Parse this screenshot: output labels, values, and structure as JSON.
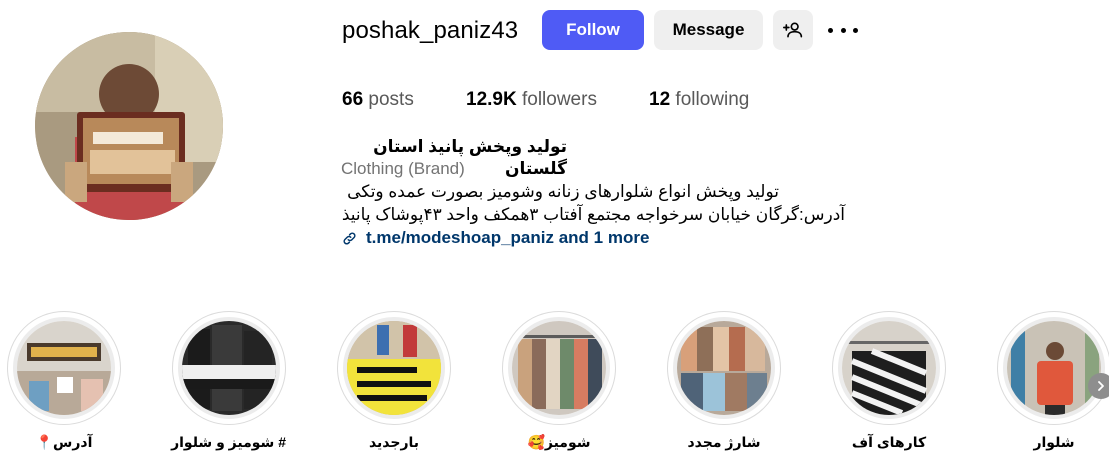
{
  "profile": {
    "username": "poshak_paniz43",
    "follow_label": "Follow",
    "message_label": "Message",
    "add_user_icon": "person-add-icon",
    "more_icon": "more-dots-icon",
    "colors": {
      "accent": "#4f5bf5",
      "button_bg": "#efefef",
      "link": "#00376b",
      "muted": "#737373"
    }
  },
  "stats": {
    "posts_count": "66",
    "posts_label": "posts",
    "followers_count": "12.9K",
    "followers_label": "followers",
    "following_count": "12",
    "following_label": "following"
  },
  "bio": {
    "name": "تولید وپخش پانیذ استان گلستان",
    "category": "Clothing (Brand)",
    "line1": "تولید وپخش انواع شلوارهای زنانه وشومیز بصورت عمده وتکی",
    "line2": "آدرس:گرگان خیابان سرخواجه مجتمع آفتاب ۳همکف واحد ۴۳پوشاک پانیذ",
    "link_text": "t.me/modeshoap_paniz and 1 more",
    "link_icon": "link-icon"
  },
  "highlights": [
    {
      "label": "آدرس📍"
    },
    {
      "label": "# شومیز و شلوار"
    },
    {
      "label": "بارجدید"
    },
    {
      "label": "شومیز🥰"
    },
    {
      "label": "شارژ مجدد"
    },
    {
      "label": "کارهای آف"
    },
    {
      "label": "شلوار"
    }
  ],
  "highlight_next_icon": "chevron-right-icon"
}
